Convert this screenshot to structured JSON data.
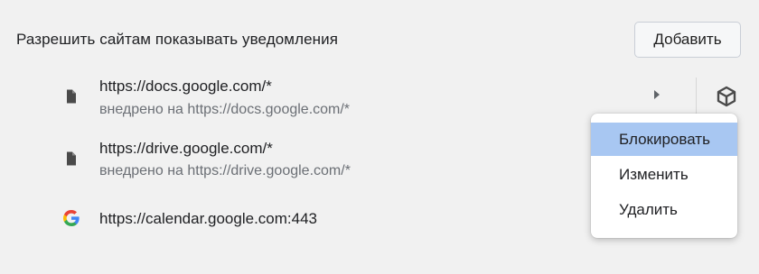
{
  "header": {
    "title": "Разрешить сайтам показывать уведомления",
    "add_button_label": "Добавить"
  },
  "sites": [
    {
      "url": "https://docs.google.com/*",
      "embedded": "внедрено на https://docs.google.com/*",
      "icon": "document-icon"
    },
    {
      "url": "https://drive.google.com/*",
      "embedded": "внедрено на https://drive.google.com/*",
      "icon": "document-icon"
    },
    {
      "url": "https://calendar.google.com:443",
      "icon": "google-g-icon"
    }
  ],
  "menu": {
    "items": [
      {
        "label": "Блокировать",
        "highlighted": true
      },
      {
        "label": "Изменить"
      },
      {
        "label": "Удалить"
      }
    ]
  },
  "colors": {
    "background": "#f1f1f1",
    "menu_highlight": "#a8c7f2",
    "secondary_text": "#6b6f75"
  }
}
